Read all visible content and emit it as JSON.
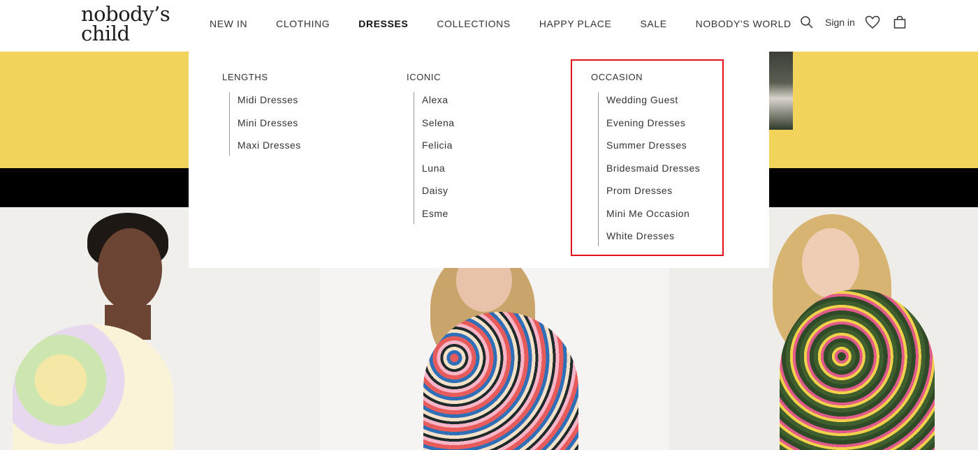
{
  "brand": {
    "line1": "nobody’s",
    "line2": "child"
  },
  "nav": {
    "items": [
      {
        "label": "NEW IN",
        "active": false
      },
      {
        "label": "CLOTHING",
        "active": false
      },
      {
        "label": "DRESSES",
        "active": true
      },
      {
        "label": "COLLECTIONS",
        "active": false
      },
      {
        "label": "HAPPY PLACE",
        "active": false
      },
      {
        "label": "SALE",
        "active": false
      },
      {
        "label": "NOBODY'S WORLD",
        "active": false
      }
    ]
  },
  "actions": {
    "search_icon": "search-icon",
    "sign_in": "Sign in",
    "wishlist_icon": "heart-icon",
    "bag_icon": "bag-icon"
  },
  "mega_menu": {
    "columns": [
      {
        "heading": "LENGTHS",
        "items": [
          "Midi Dresses",
          "Mini Dresses",
          "Maxi Dresses"
        ]
      },
      {
        "heading": "ICONIC",
        "items": [
          "Alexa",
          "Selena",
          "Felicia",
          "Luna",
          "Daisy",
          "Esme"
        ]
      },
      {
        "heading": "OCCASION",
        "items": [
          "Wedding Guest",
          "Evening Dresses",
          "Summer Dresses",
          "Bridesmaid Dresses",
          "Prom Dresses",
          "Mini Me Occasion",
          "White Dresses"
        ]
      }
    ]
  },
  "colors": {
    "hero_yellow": "#f2d35c",
    "hero_black": "#000000",
    "highlight_red": "#e3101c"
  }
}
